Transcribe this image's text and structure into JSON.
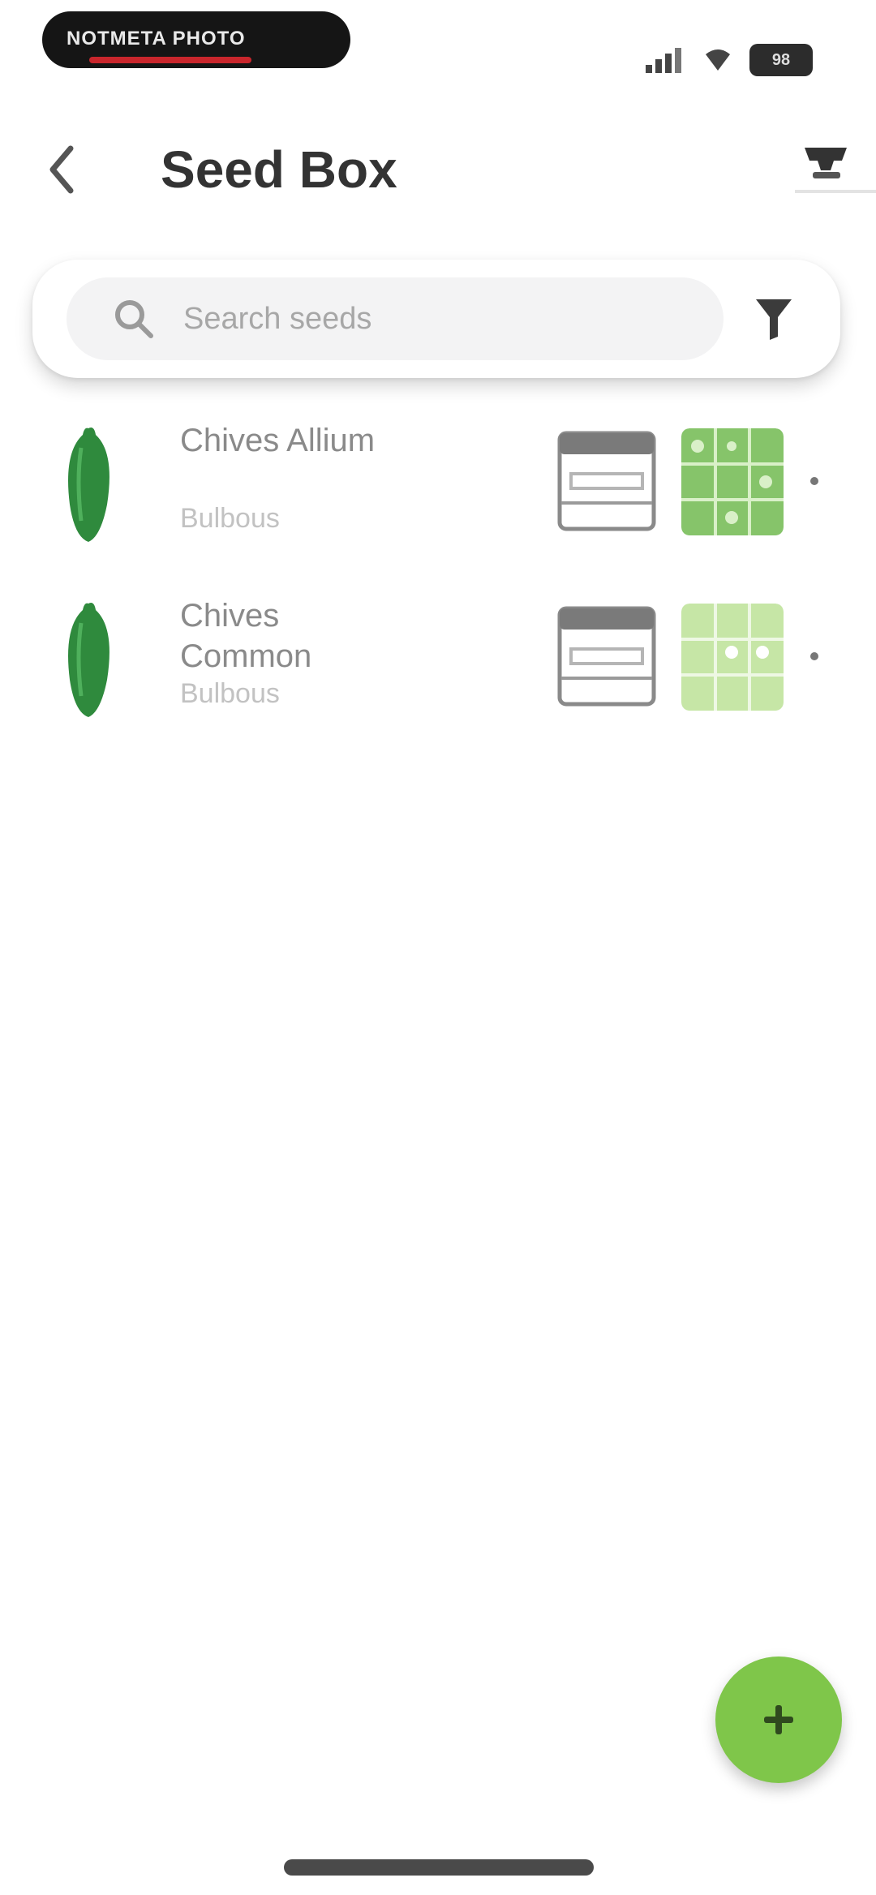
{
  "status_bar": {
    "pill_text": "NOTMETA PHOTO",
    "battery_label": "98"
  },
  "header": {
    "title": "Seed Box",
    "back_icon": "chevron-left-icon",
    "action_icon": "seed-box-icon"
  },
  "search": {
    "placeholder": "Search seeds",
    "search_icon": "search-icon",
    "filter_icon": "filter-icon"
  },
  "seeds": [
    {
      "name": "Chives Allium",
      "category": "Bulbous",
      "thumb_color": "#86c46a",
      "icon": "pepper-icon"
    },
    {
      "name": "Chives Common",
      "category": "Bulbous",
      "thumb_color": "#c6e6a6",
      "icon": "pepper-icon"
    }
  ],
  "fab": {
    "label": "+",
    "icon": "plus-icon"
  },
  "colors": {
    "accent": "#7fc64a",
    "pepper": "#2f8a3d",
    "background": "#ffffff"
  }
}
